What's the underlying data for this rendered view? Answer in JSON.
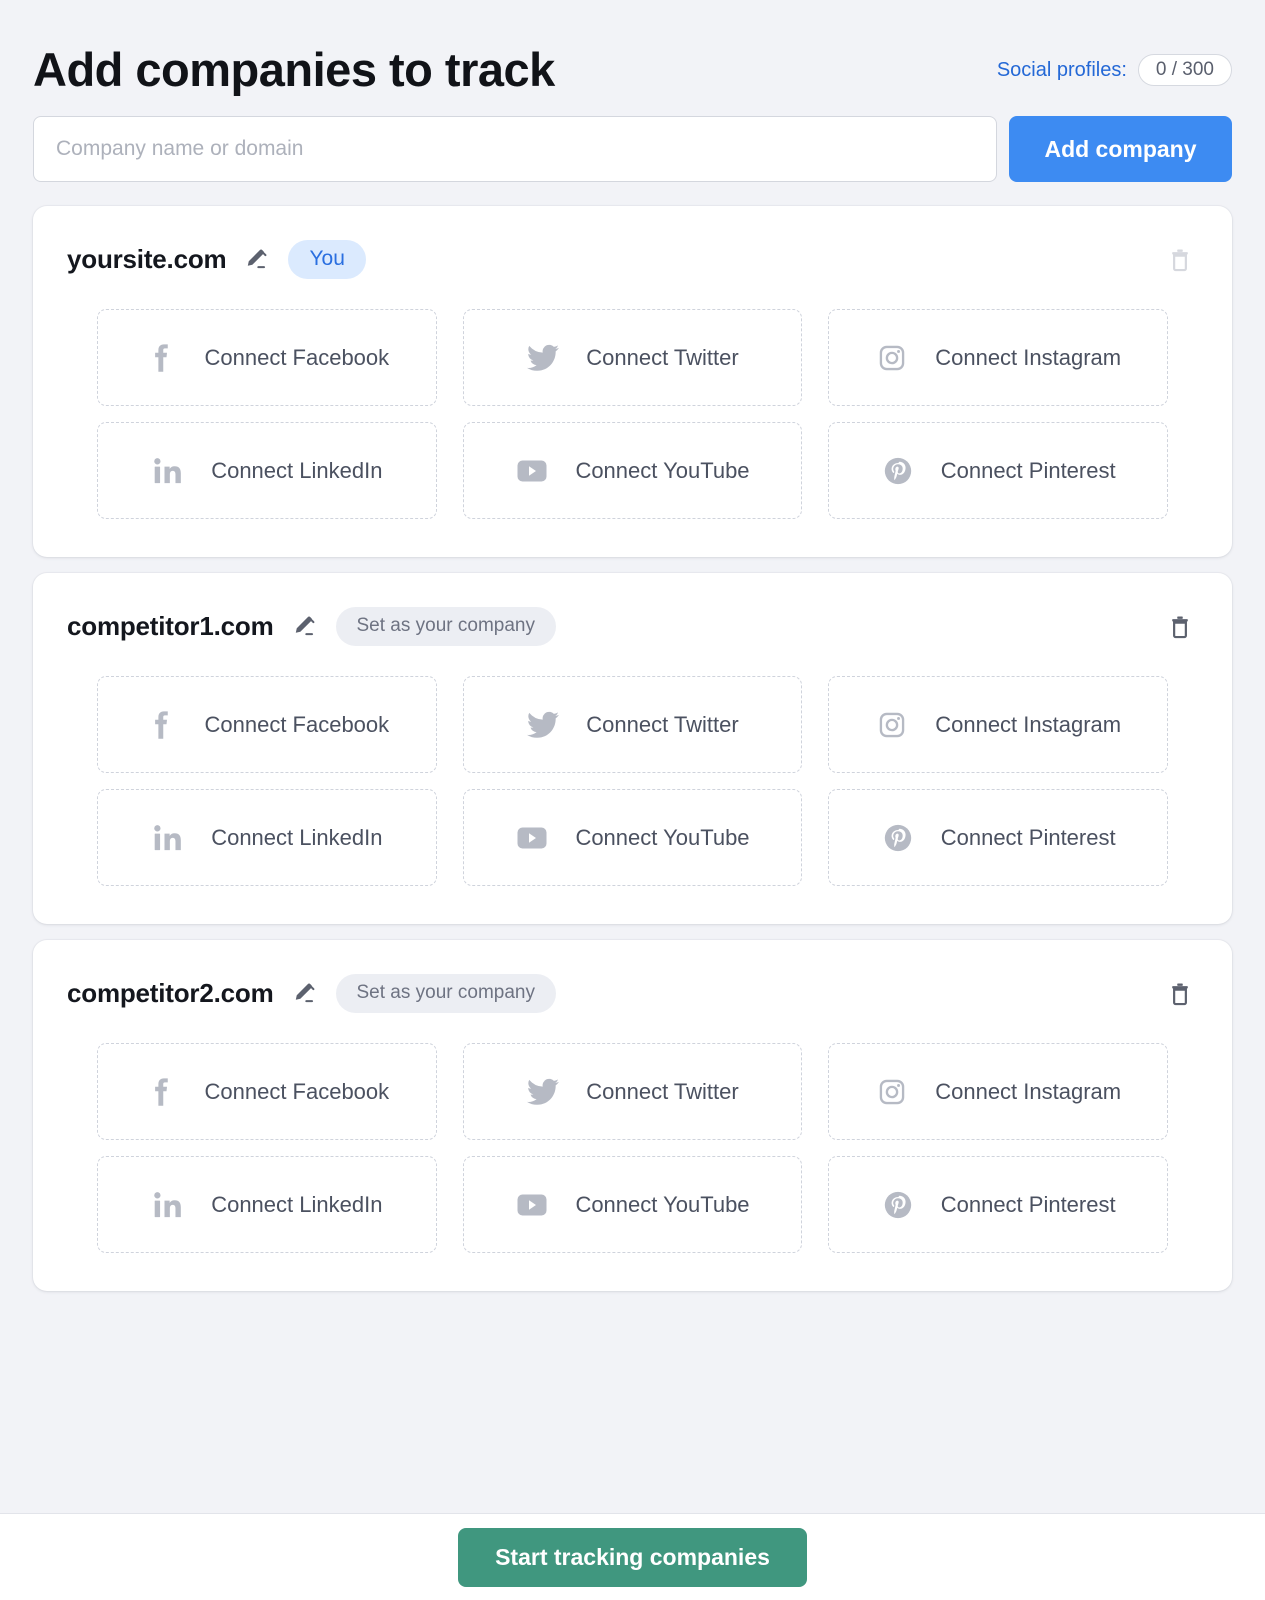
{
  "header": {
    "title": "Add companies to track",
    "social_profiles_label": "Social profiles:",
    "social_profiles_count": "0 / 300"
  },
  "search": {
    "placeholder": "Company name or domain",
    "value": "",
    "add_button_label": "Add company"
  },
  "colors": {
    "page_bg": "#f2f3f7",
    "card_bg": "#ffffff",
    "accent_blue": "#3d8bf2",
    "link_blue": "#2468d6",
    "badge_you_bg": "#dbeafe",
    "badge_you_text": "#2a6fe0",
    "badge_set_bg": "#eceef3",
    "badge_set_text": "#6e7382",
    "start_button_green": "#40977f",
    "dashed_border": "#cfd3dc",
    "muted_icon": "#b6bac4"
  },
  "companies": [
    {
      "name": "yoursite.com",
      "edit_icon": "pencil-icon",
      "badge_label": "You",
      "badge_type": "you",
      "delete_icon": "trash-icon",
      "delete_enabled": false,
      "connections": [
        {
          "network": "facebook",
          "icon": "facebook-icon",
          "label": "Connect Facebook"
        },
        {
          "network": "twitter",
          "icon": "twitter-icon",
          "label": "Connect Twitter"
        },
        {
          "network": "instagram",
          "icon": "instagram-icon",
          "label": "Connect Instagram"
        },
        {
          "network": "linkedin",
          "icon": "linkedin-icon",
          "label": "Connect LinkedIn"
        },
        {
          "network": "youtube",
          "icon": "youtube-icon",
          "label": "Connect YouTube"
        },
        {
          "network": "pinterest",
          "icon": "pinterest-icon",
          "label": "Connect Pinterest"
        }
      ]
    },
    {
      "name": "competitor1.com",
      "edit_icon": "pencil-icon",
      "badge_label": "Set as your company",
      "badge_type": "set",
      "delete_icon": "trash-icon",
      "delete_enabled": true,
      "connections": [
        {
          "network": "facebook",
          "icon": "facebook-icon",
          "label": "Connect Facebook"
        },
        {
          "network": "twitter",
          "icon": "twitter-icon",
          "label": "Connect Twitter"
        },
        {
          "network": "instagram",
          "icon": "instagram-icon",
          "label": "Connect Instagram"
        },
        {
          "network": "linkedin",
          "icon": "linkedin-icon",
          "label": "Connect LinkedIn"
        },
        {
          "network": "youtube",
          "icon": "youtube-icon",
          "label": "Connect YouTube"
        },
        {
          "network": "pinterest",
          "icon": "pinterest-icon",
          "label": "Connect Pinterest"
        }
      ]
    },
    {
      "name": "competitor2.com",
      "edit_icon": "pencil-icon",
      "badge_label": "Set as your company",
      "badge_type": "set",
      "delete_icon": "trash-icon",
      "delete_enabled": true,
      "connections": [
        {
          "network": "facebook",
          "icon": "facebook-icon",
          "label": "Connect Facebook"
        },
        {
          "network": "twitter",
          "icon": "twitter-icon",
          "label": "Connect Twitter"
        },
        {
          "network": "instagram",
          "icon": "instagram-icon",
          "label": "Connect Instagram"
        },
        {
          "network": "linkedin",
          "icon": "linkedin-icon",
          "label": "Connect LinkedIn"
        },
        {
          "network": "youtube",
          "icon": "youtube-icon",
          "label": "Connect YouTube"
        },
        {
          "network": "pinterest",
          "icon": "pinterest-icon",
          "label": "Connect Pinterest"
        }
      ]
    }
  ],
  "footer": {
    "start_button_label": "Start tracking companies"
  }
}
